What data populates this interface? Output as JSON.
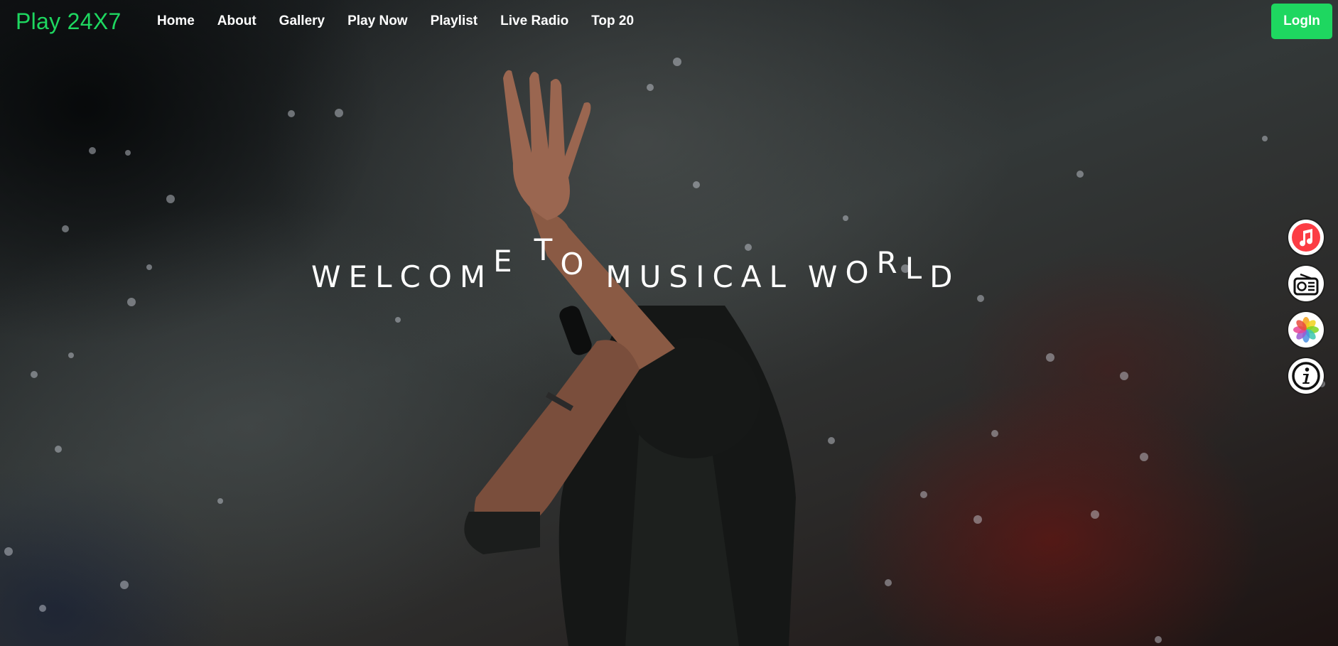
{
  "nav": {
    "brand": "Play 24X7",
    "links": [
      "Home",
      "About",
      "Gallery",
      "Play Now",
      "Playlist",
      "Live Radio",
      "Top 20"
    ],
    "login_label": "LogIn"
  },
  "hero": {
    "headline_words": [
      "WELCOME",
      "TO",
      "MUSICAL",
      "WORLD"
    ]
  },
  "dock": {
    "items": [
      {
        "icon": "music-icon",
        "color": "#fc3c44"
      },
      {
        "icon": "radio-icon",
        "color": "#111111"
      },
      {
        "icon": "photos-icon",
        "color": "#f5a623"
      },
      {
        "icon": "info-icon",
        "color": "#111111"
      }
    ]
  },
  "colors": {
    "accent": "#1ed760",
    "text": "#ffffff"
  }
}
